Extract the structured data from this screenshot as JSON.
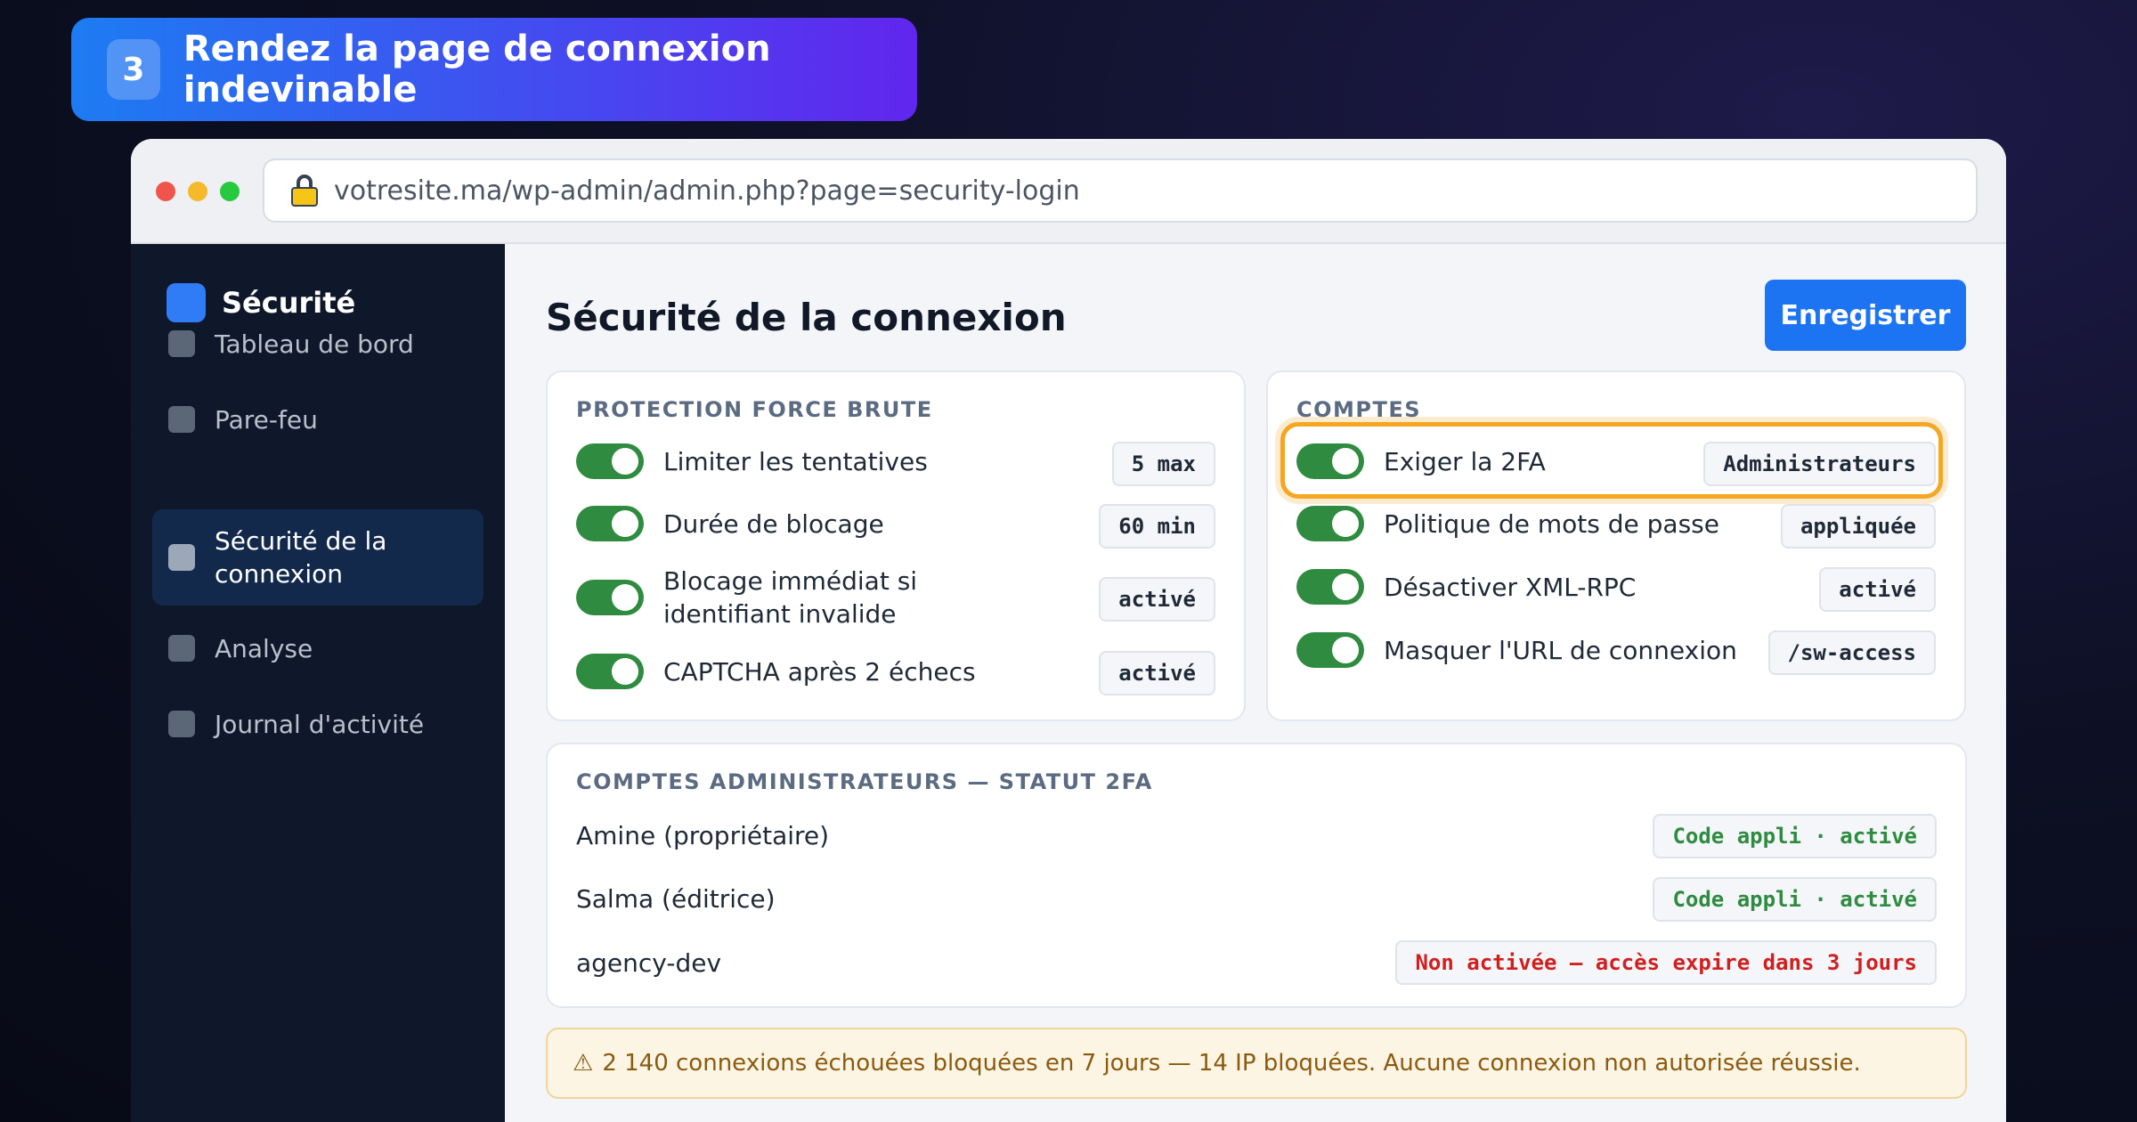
{
  "step_badge": {
    "number": "3",
    "title": "Rendez la page de connexion indevinable"
  },
  "browser": {
    "url": "votresite.ma/wp-admin/admin.php?page=security-login"
  },
  "sidebar": {
    "brand": "Sécurité",
    "items": [
      {
        "label": "Tableau de bord",
        "active": false
      },
      {
        "label": "Pare-feu",
        "active": false
      },
      {
        "label": "Sécurité de la connexion",
        "active": true
      },
      {
        "label": "Analyse",
        "active": false
      },
      {
        "label": "Journal d'activité",
        "active": false
      }
    ]
  },
  "main": {
    "title": "Sécurité de la connexion",
    "save_label": "Enregistrer",
    "brute_force": {
      "heading": "PROTECTION FORCE BRUTE",
      "rows": [
        {
          "label": "Limiter les tentatives",
          "value": "5 max",
          "enabled": true
        },
        {
          "label": "Durée de blocage",
          "value": "60 min",
          "enabled": true
        },
        {
          "label": "Blocage immédiat si identifiant invalide",
          "value": "activé",
          "enabled": true
        },
        {
          "label": "CAPTCHA après 2 échecs",
          "value": "activé",
          "enabled": true
        }
      ]
    },
    "accounts": {
      "heading": "COMPTES",
      "rows": [
        {
          "label": "Exiger la 2FA",
          "value": "Administrateurs",
          "enabled": true,
          "highlighted": true
        },
        {
          "label": "Politique de mots de passe",
          "value": "appliquée",
          "enabled": true
        },
        {
          "label": "Désactiver XML-RPC",
          "value": "activé",
          "enabled": true
        },
        {
          "label": "Masquer l'URL de connexion",
          "value": "/sw-access",
          "enabled": true
        }
      ]
    },
    "admins": {
      "heading": "COMPTES ADMINISTRATEURS — STATUT 2FA",
      "rows": [
        {
          "name": "Amine (propriétaire)",
          "status": "Code appli · activé",
          "status_color": "#2e8b3f"
        },
        {
          "name": "Salma (éditrice)",
          "status": "Code appli · activé",
          "status_color": "#2e8b3f"
        },
        {
          "name": "agency-dev",
          "status": "Non activée — accès expire dans 3 jours",
          "status_color": "#d11f1f"
        }
      ]
    },
    "alert": {
      "icon": "⚠",
      "text": "2 140 connexions échouées bloquées en 7 jours — 14 IP bloquées. Aucune connexion non autorisée réussie."
    }
  }
}
